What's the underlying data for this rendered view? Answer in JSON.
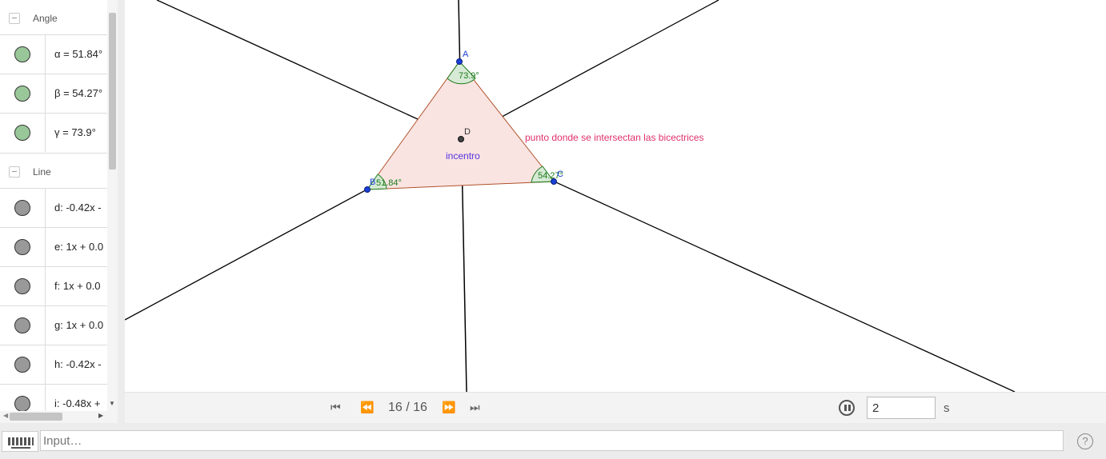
{
  "algebra": {
    "groups": [
      {
        "label": "Angle",
        "items": [
          {
            "text": "α = 51.84°",
            "color": "#99c799"
          },
          {
            "text": "β = 54.27°",
            "color": "#99c799"
          },
          {
            "text": "γ = 73.9°",
            "color": "#99c799"
          }
        ]
      },
      {
        "label": "Line",
        "items": [
          {
            "text": "d: -0.42x -",
            "color": "#999999"
          },
          {
            "text": "e: 1x + 0.0",
            "color": "#999999"
          },
          {
            "text": "f: 1x + 0.0",
            "color": "#999999"
          },
          {
            "text": "g: 1x + 0.0",
            "color": "#999999"
          },
          {
            "text": "h: -0.42x -",
            "color": "#999999"
          },
          {
            "text": "i: -0.48x +",
            "color": "#999999"
          }
        ]
      }
    ]
  },
  "graphics": {
    "point_labels": {
      "a": "A",
      "b": "B",
      "c": "C",
      "d": "D"
    },
    "angle_labels": {
      "alpha": "51.84°",
      "beta": "54.27°",
      "gamma": "73.9°"
    },
    "annotation": "punto donde se intersectan  las bicectrices",
    "incenter_label": "incentro",
    "colors": {
      "triangle_fill": "#f9e4e2",
      "triangle_edge": "#b0522a",
      "angle_fill": "#d7ead5",
      "angle_text": "#1a7a1a",
      "point": "#1a3fd6",
      "annotation": "#e0306a",
      "incenter_text": "#5533dd"
    }
  },
  "animation": {
    "first": "⏮",
    "prev": "⏪",
    "next": "⏩",
    "last": "⏭",
    "frame": "16 / 16",
    "speed": "2",
    "unit": "s"
  },
  "input": {
    "placeholder": "Input…",
    "help": "?"
  }
}
